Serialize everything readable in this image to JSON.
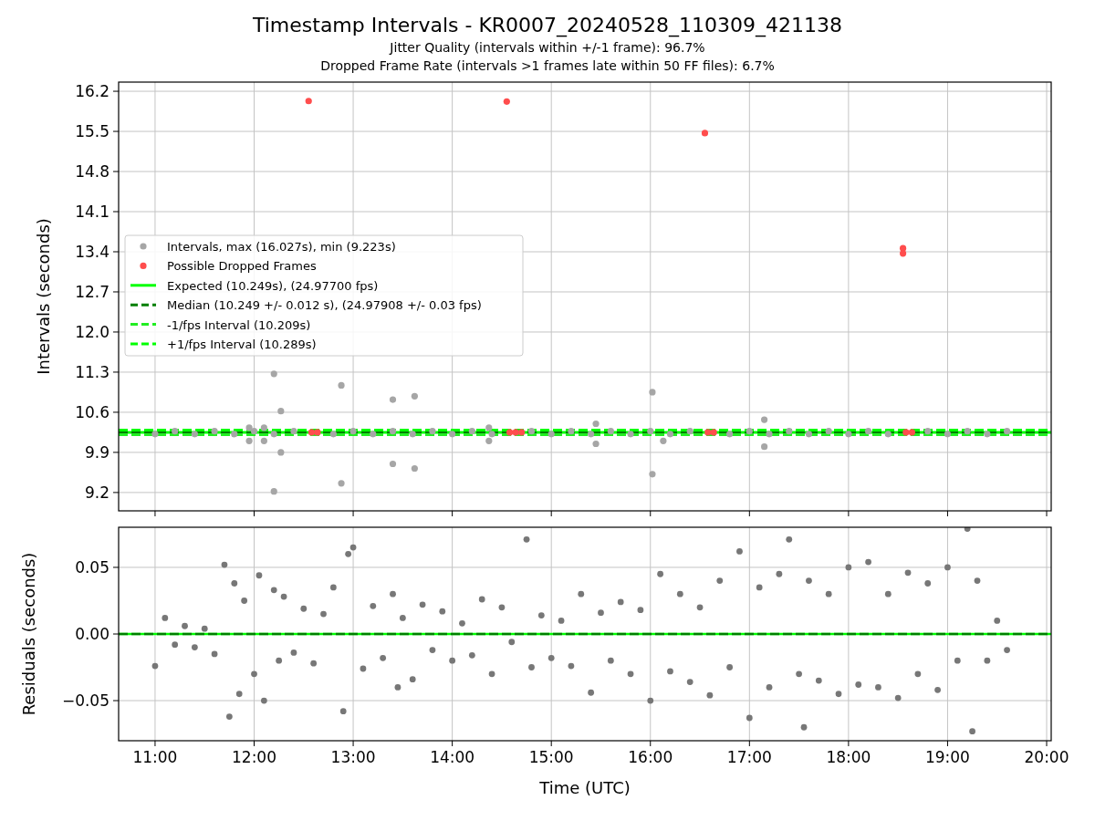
{
  "figure": {
    "title": "Timestamp Intervals - KR0007_20240528_110309_421138",
    "subtitles": [
      "Jitter Quality (intervals within +/-1 frame): 96.7%",
      "Dropped Frame Rate (intervals >1 frames late within 50 FF files): 6.7%"
    ]
  },
  "intervals_panel": {
    "chart_data": {
      "type": "scatter",
      "ylabel": "Intervals (seconds)",
      "grid": true,
      "legend": true,
      "xlim": [
        10.632,
        20.046
      ],
      "ylim": [
        8.88,
        16.36
      ],
      "yticks": [
        {
          "value": 9.2,
          "label": "9.2"
        },
        {
          "value": 9.9,
          "label": "9.9"
        },
        {
          "value": 10.6,
          "label": "10.6"
        },
        {
          "value": 11.3,
          "label": "11.3"
        },
        {
          "value": 12.0,
          "label": "12.0"
        },
        {
          "value": 12.7,
          "label": "12.7"
        },
        {
          "value": 13.4,
          "label": "13.4"
        },
        {
          "value": 14.1,
          "label": "14.1"
        },
        {
          "value": 14.8,
          "label": "14.8"
        },
        {
          "value": 15.5,
          "label": "15.5"
        },
        {
          "value": 16.2,
          "label": "16.2"
        }
      ],
      "series": [
        {
          "name": "Intervals, max (16.027s), min (9.223s)",
          "color": "#a6a6a6",
          "x": [
            11.0,
            11.2,
            11.4,
            11.6,
            11.8,
            12.0,
            12.2,
            12.4,
            12.8,
            13.0,
            13.2,
            13.4,
            13.6,
            13.8,
            14.0,
            14.2,
            14.4,
            14.8,
            15.0,
            15.2,
            15.4,
            15.6,
            15.8,
            16.0,
            16.2,
            16.4,
            16.8,
            17.0,
            17.2,
            17.4,
            17.6,
            17.8,
            18.0,
            18.2,
            18.4,
            18.8,
            19.0,
            19.2,
            19.4,
            19.6,
            12.2,
            12.27,
            12.88,
            13.4,
            13.62,
            16.02,
            17.15,
            11.95,
            12.1,
            14.37,
            15.45,
            11.95,
            12.1,
            12.27,
            14.37,
            15.45,
            16.13,
            17.15,
            13.4,
            13.62,
            12.88,
            16.02,
            12.2
          ],
          "values": [
            10.22,
            10.27,
            10.22,
            10.27,
            10.22,
            10.27,
            10.22,
            10.27,
            10.22,
            10.27,
            10.22,
            10.27,
            10.22,
            10.27,
            10.22,
            10.27,
            10.22,
            10.27,
            10.22,
            10.27,
            10.22,
            10.27,
            10.22,
            10.27,
            10.22,
            10.27,
            10.22,
            10.27,
            10.22,
            10.27,
            10.22,
            10.27,
            10.22,
            10.27,
            10.22,
            10.27,
            10.22,
            10.27,
            10.22,
            10.27,
            11.27,
            10.62,
            11.07,
            10.82,
            10.88,
            10.95,
            10.47,
            10.33,
            10.33,
            10.33,
            10.4,
            10.1,
            10.1,
            9.9,
            10.1,
            10.05,
            10.1,
            10.0,
            9.7,
            9.62,
            9.36,
            9.52,
            9.22
          ]
        },
        {
          "name": "Possible Dropped Frames",
          "color": "#ff4d4d",
          "x": [
            12.55,
            14.55,
            16.55,
            18.55,
            18.55,
            12.58,
            12.64,
            14.58,
            14.64,
            14.7,
            16.58,
            16.64,
            18.58,
            18.64
          ],
          "values": [
            16.03,
            16.02,
            15.47,
            13.46,
            13.37,
            10.25,
            10.25,
            10.25,
            10.25,
            10.25,
            10.25,
            10.25,
            10.25,
            10.25
          ]
        }
      ],
      "ref_lines": [
        {
          "axis": "y",
          "value": 10.249,
          "label": "Expected (10.249s), (24.97700 fps)",
          "color": "#00ff00"
        },
        {
          "axis": "y",
          "value": 10.249,
          "label": "Median (10.249 +/- 0.012 s), (24.97908 +/- 0.03 fps)",
          "color": "#007f00"
        },
        {
          "axis": "y",
          "value": 10.209,
          "label": "-1/fps Interval (10.209s)",
          "color": "#22ee22"
        },
        {
          "axis": "y",
          "value": 10.289,
          "label": "+1/fps Interval (10.289s)",
          "color": "#00ff00"
        }
      ]
    }
  },
  "residuals_panel": {
    "chart_data": {
      "type": "scatter",
      "xlabel": "Time (UTC)",
      "ylabel": "Residuals (seconds)",
      "grid": true,
      "xlim": [
        10.632,
        20.046
      ],
      "ylim": [
        -0.0801,
        0.0801
      ],
      "xticks": [
        {
          "value": 11,
          "label": "11:00"
        },
        {
          "value": 12,
          "label": "12:00"
        },
        {
          "value": 13,
          "label": "13:00"
        },
        {
          "value": 14,
          "label": "14:00"
        },
        {
          "value": 15,
          "label": "15:00"
        },
        {
          "value": 16,
          "label": "16:00"
        },
        {
          "value": 17,
          "label": "17:00"
        },
        {
          "value": 18,
          "label": "18:00"
        },
        {
          "value": 19,
          "label": "19:00"
        },
        {
          "value": 20,
          "label": "20:00"
        }
      ],
      "yticks": [
        {
          "value": -0.05,
          "label": "−0.05"
        },
        {
          "value": 0,
          "label": "0.00"
        },
        {
          "value": 0.05,
          "label": "0.05"
        }
      ],
      "series": [
        {
          "color": "#777777",
          "x": [
            11.0,
            11.1,
            11.2,
            11.3,
            11.4,
            11.5,
            11.6,
            11.7,
            11.75,
            11.8,
            11.85,
            11.9,
            12.0,
            12.05,
            12.1,
            12.2,
            12.25,
            12.3,
            12.4,
            12.5,
            12.6,
            12.7,
            12.8,
            12.9,
            12.95,
            13.0,
            13.1,
            13.2,
            13.3,
            13.4,
            13.45,
            13.5,
            13.6,
            13.7,
            13.8,
            13.9,
            14.0,
            14.1,
            14.2,
            14.3,
            14.4,
            14.5,
            14.6,
            14.75,
            14.8,
            14.9,
            15.0,
            15.1,
            15.2,
            15.3,
            15.4,
            15.5,
            15.6,
            15.7,
            15.8,
            15.9,
            16.0,
            16.1,
            16.2,
            16.3,
            16.4,
            16.5,
            16.6,
            16.7,
            16.8,
            16.9,
            17.0,
            17.1,
            17.2,
            17.3,
            17.4,
            17.5,
            17.55,
            17.6,
            17.7,
            17.8,
            17.9,
            18.0,
            18.1,
            18.2,
            18.3,
            18.4,
            18.5,
            18.6,
            18.7,
            18.8,
            18.9,
            19.0,
            19.1,
            19.2,
            19.25,
            19.3,
            19.4,
            19.5,
            19.6
          ],
          "values": [
            -0.024,
            0.012,
            -0.008,
            0.006,
            -0.01,
            0.004,
            -0.015,
            0.052,
            -0.062,
            0.038,
            -0.045,
            0.025,
            -0.03,
            0.044,
            -0.05,
            0.033,
            -0.02,
            0.028,
            -0.014,
            0.019,
            -0.022,
            0.015,
            0.035,
            -0.058,
            0.06,
            0.065,
            -0.026,
            0.021,
            -0.018,
            0.03,
            -0.04,
            0.012,
            -0.034,
            0.022,
            -0.012,
            0.017,
            -0.02,
            0.008,
            -0.016,
            0.026,
            -0.03,
            0.02,
            -0.006,
            0.071,
            -0.025,
            0.014,
            -0.018,
            0.01,
            -0.024,
            0.03,
            -0.044,
            0.016,
            -0.02,
            0.024,
            -0.03,
            0.018,
            -0.05,
            0.045,
            -0.028,
            0.03,
            -0.036,
            0.02,
            -0.046,
            0.04,
            -0.025,
            0.062,
            -0.063,
            0.035,
            -0.04,
            0.045,
            0.071,
            -0.03,
            -0.07,
            0.04,
            -0.035,
            0.03,
            -0.045,
            0.05,
            -0.038,
            0.054,
            -0.04,
            0.03,
            -0.048,
            0.046,
            -0.03,
            0.038,
            -0.042,
            0.05,
            -0.02,
            0.079,
            -0.073,
            0.04,
            -0.02,
            0.01,
            -0.012
          ]
        }
      ],
      "ref_lines": [
        {
          "axis": "y",
          "value": 0,
          "color": "#00ff00"
        },
        {
          "axis": "y",
          "value": 0,
          "color": "#007f00"
        }
      ]
    }
  }
}
